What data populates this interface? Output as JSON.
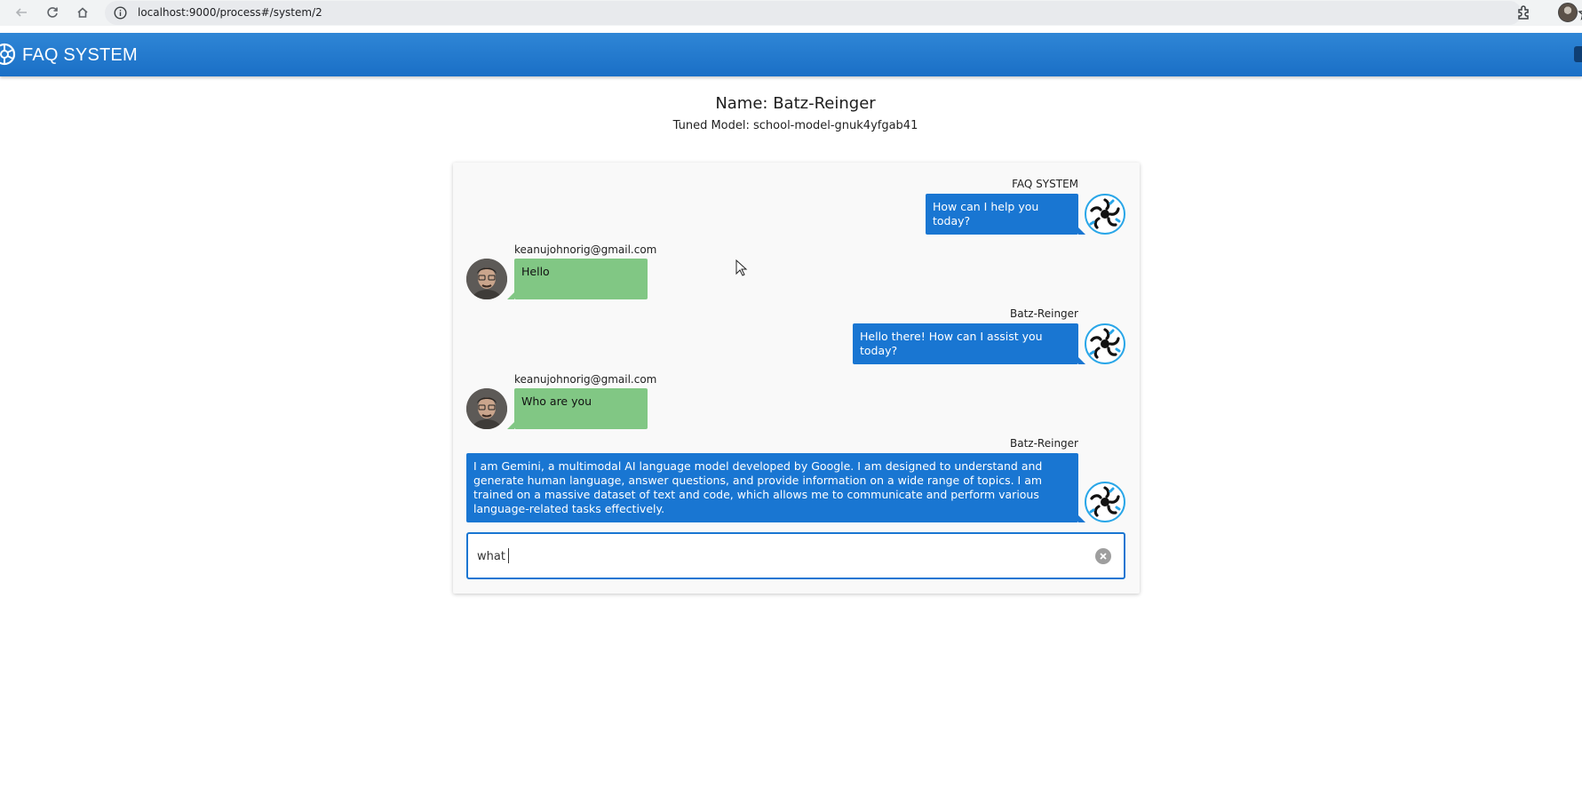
{
  "browser": {
    "url": "localhost:9000/process#/system/2"
  },
  "header": {
    "title": "FAQ SYSTEM"
  },
  "page": {
    "name": "Name: Batz-Reinger",
    "model": "Tuned Model: school-model-gnuk4yfgab41"
  },
  "messages": [
    {
      "role": "bot",
      "sender": "FAQ SYSTEM",
      "text": "How can I help you today?"
    },
    {
      "role": "user",
      "sender": "keanujohnorig@gmail.com",
      "text": "Hello"
    },
    {
      "role": "bot",
      "sender": "Batz-Reinger",
      "text": "Hello there! How can I assist you today?"
    },
    {
      "role": "user",
      "sender": "keanujohnorig@gmail.com",
      "text": "Who are you"
    },
    {
      "role": "bot",
      "sender": "Batz-Reinger",
      "text": "I am Gemini, a multimodal AI language model developed by Google. I am designed to understand and generate human language, answer questions, and provide information on a wide range of topics. I am trained on a massive dataset of text and code, which allows me to communicate and perform various language-related tasks effectively."
    }
  ],
  "input": {
    "value": "what "
  },
  "colors": {
    "header": "#1a6fc6",
    "bot_bubble": "#1976d2",
    "user_bubble": "#81c784",
    "avatar_ring": "#29a6e8"
  }
}
